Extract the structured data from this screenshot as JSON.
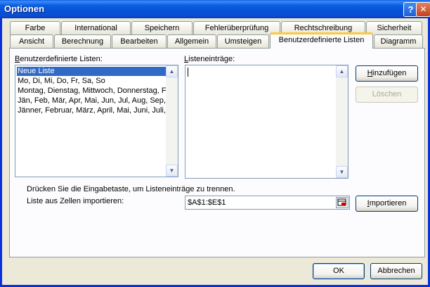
{
  "window": {
    "title": "Optionen",
    "help_glyph": "?",
    "close_glyph": "✕"
  },
  "tabs_row1": [
    {
      "label": "Farbe"
    },
    {
      "label": "International"
    },
    {
      "label": "Speichern"
    },
    {
      "label": "Fehlerüberprüfung"
    },
    {
      "label": "Rechtschreibung"
    },
    {
      "label": "Sicherheit"
    }
  ],
  "tabs_row2": [
    {
      "label": "Ansicht"
    },
    {
      "label": "Berechnung"
    },
    {
      "label": "Bearbeiten"
    },
    {
      "label": "Allgemein"
    },
    {
      "label": "Umsteigen"
    },
    {
      "label": "Benutzerdefinierte Listen",
      "active": true
    },
    {
      "label": "Diagramm"
    }
  ],
  "custom_lists": {
    "label_first": "B",
    "label_rest": "enutzerdefinierte Listen:",
    "items": [
      "Neue Liste",
      "Mo, Di, Mi, Do, Fr, Sa, So",
      "Montag, Dienstag, Mittwoch, Donnerstag, F",
      "Jän, Feb, Mär, Apr, Mai, Jun, Jul, Aug, Sep,",
      "Jänner, Februar, März, April, Mai, Juni, Juli,"
    ],
    "selected_index": 0
  },
  "entries": {
    "label_first": "L",
    "label_rest": "isteneinträge:",
    "value": ""
  },
  "buttons": {
    "add_first": "H",
    "add_rest": "inzufügen",
    "delete": "Löschen",
    "import_first": "I",
    "import_rest": "mportieren",
    "ok": "OK",
    "cancel": "Abbrechen"
  },
  "hint": "Drücken Sie die Eingabetaste, um Listeneinträge zu trennen.",
  "import_label": "Liste aus Zellen importieren:",
  "import_range": "$A$1:$E$1",
  "colors": {
    "title_bar": "#0A4ED0",
    "selection": "#316AC5",
    "active_tab_accent": "#FFC83C"
  }
}
